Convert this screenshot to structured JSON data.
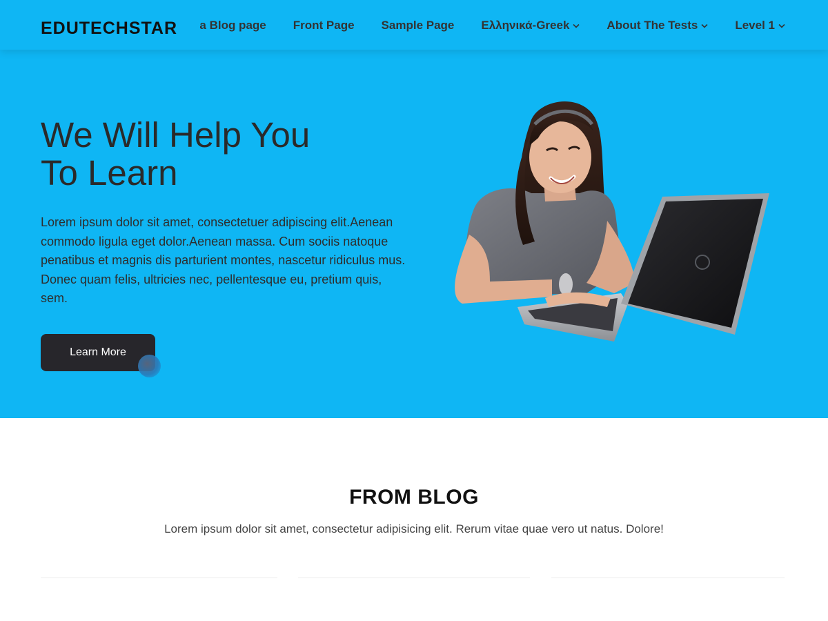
{
  "brand": {
    "name": "EDUTECHSTAR"
  },
  "nav": {
    "items": [
      {
        "label": "a Blog page",
        "has_dropdown": false
      },
      {
        "label": "Front Page",
        "has_dropdown": false
      },
      {
        "label": "Sample Page",
        "has_dropdown": false
      },
      {
        "label": "Ελληνικά-Greek",
        "has_dropdown": true
      },
      {
        "label": "About The Tests",
        "has_dropdown": true
      },
      {
        "label": "Level 1",
        "has_dropdown": true
      }
    ]
  },
  "hero": {
    "title_line1": "We Will Help You",
    "title_line2": "To Learn",
    "text": "Lorem ipsum dolor sit amet, consectetuer adipiscing elit.Aenean commodo ligula eget dolor.Aenean massa. Cum sociis natoque penatibus et magnis dis parturient montes, nascetur ridiculus mus. Donec quam felis, ultricies nec, pellentesque eu, pretium quis, sem.",
    "button_label": "Learn More"
  },
  "blog": {
    "title": "FROM BLOG",
    "subtitle": "Lorem ipsum dolor sit amet, consectetur adipisicing elit. Rerum vitae quae vero ut natus. Dolore!"
  },
  "icons": {
    "dropdown": "chevron-down-icon",
    "illustration": "student-laptop-illustration"
  },
  "colors": {
    "header_bg": "#0fb6f4",
    "hero_bg": "#0fb6f4",
    "button_bg": "#27262b",
    "button_text": "#ffffff",
    "page_bg": "#ffffff"
  }
}
